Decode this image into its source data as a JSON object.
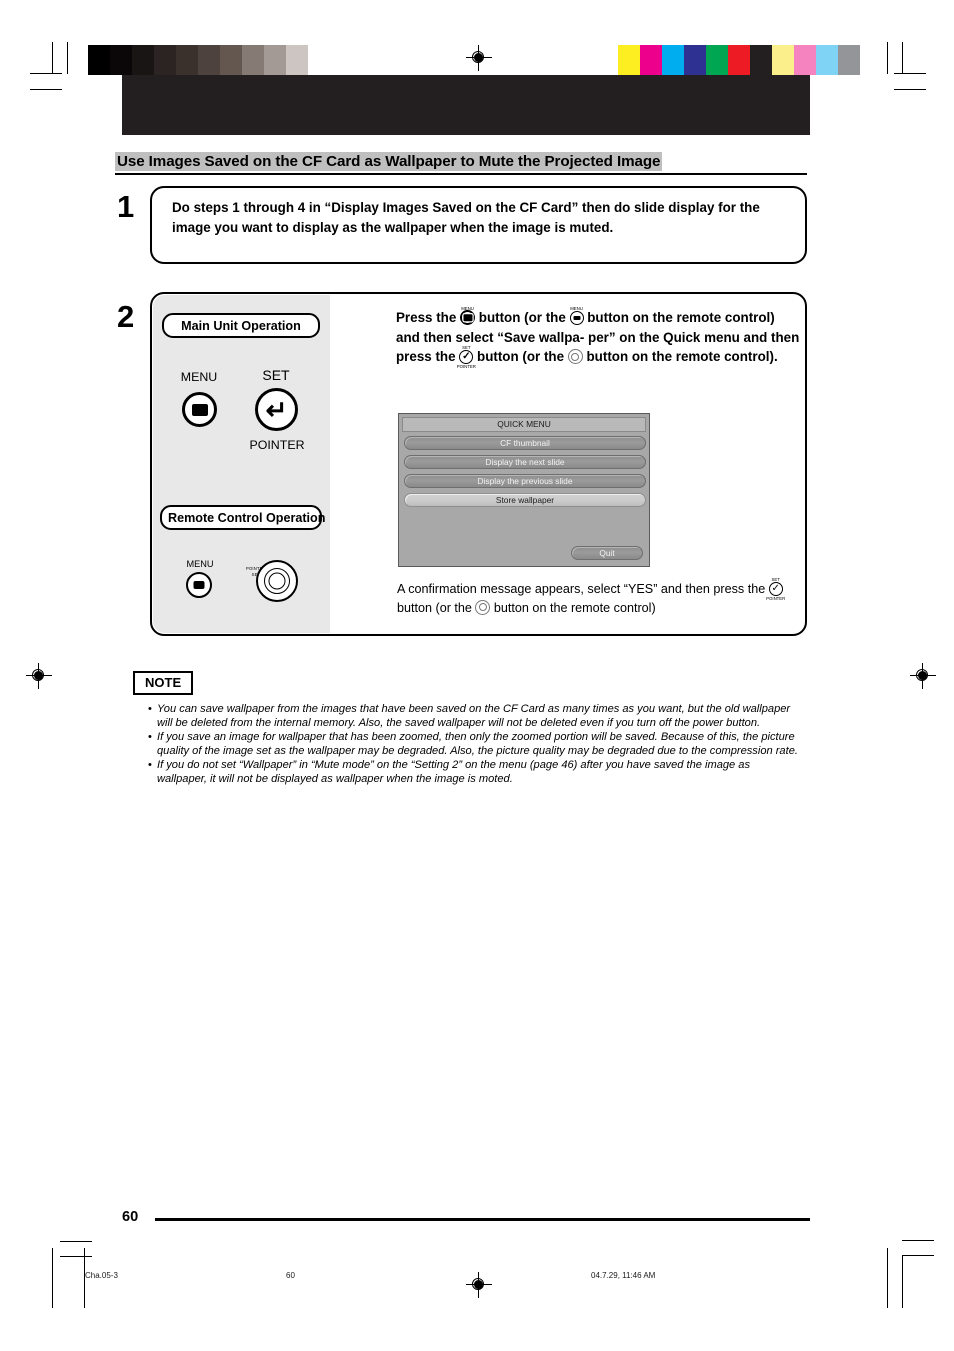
{
  "document": {
    "section_title": "Use Images Saved on the CF Card as Wallpaper to Mute the Projected Image",
    "page_number": "60"
  },
  "steps": [
    {
      "number": "1",
      "text": "Do steps 1 through 4 in “Display Images Saved on the CF Card” then do slide display for the image you want to display as the wallpaper when the image is muted."
    },
    {
      "number": "2",
      "text_parts": {
        "p1": "Press the",
        "p2": "button (or the",
        "p3": "button on the",
        "p4": "remote control) and then select “Save wallpa-",
        "p5": "per” on the Quick menu and then press the",
        "p6": "button (or the",
        "p7": "button on the remote control)."
      }
    }
  ],
  "hardware_panel": {
    "main_unit_label": "Main Unit Operation",
    "remote_label": "Remote Control Operation",
    "main_unit_buttons": [
      {
        "caption": "MENU",
        "icon": "menu-button-icon",
        "position": "above"
      },
      {
        "caption": "SET",
        "sub_caption": "POINTER",
        "icon": "set-enter-button-icon"
      }
    ],
    "remote_buttons": [
      {
        "caption": "MENU",
        "icon": "remote-menu-button-icon"
      },
      {
        "caption_top": "POINTER",
        "caption_sub": "SET",
        "icon": "remote-pointer-dial-icon"
      }
    ]
  },
  "glyph_captions": {
    "menu": "MENU",
    "set": "SET",
    "pointer": "POINTER"
  },
  "osd": {
    "title": "QUICK MENU",
    "items": [
      {
        "label": "CF thumbnail",
        "selected": false
      },
      {
        "label": "Display the next slide",
        "selected": false
      },
      {
        "label": "Display the previous slide",
        "selected": false
      },
      {
        "label": "Store wallpaper",
        "selected": true
      }
    ],
    "quit_label": "Quit"
  },
  "confirmation": {
    "line1_a": "A confirmation message appears, select “YES” and then press",
    "line2_a": "the",
    "line2_b": "button (or the",
    "line2_c": "button on the remote control)"
  },
  "note": {
    "badge": "NOTE",
    "bullet_char": "•",
    "items": [
      "You can save wallpaper from the images that have been saved on the CF Card as many times as you want, but the old wallpaper will be deleted from the internal memory. Also, the saved wallpaper will not be deleted even if you turn off the power button.",
      "If you save an image for wallpaper that has been zoomed, then only the zoomed portion will be saved. Because of this, the picture quality of the image set as the wallpaper may be degraded. Also, the picture quality may be degraded due to the compression rate.",
      "If you do not set “Wallpaper” in “Mute mode” on the “Setting 2” on the menu (page 46) after you have saved the image as wallpaper, it will not be displayed as wallpaper when the image is moted."
    ]
  },
  "imprint": {
    "file": "Cha.05-3",
    "page": "60",
    "timestamp": "04.7.29, 11:46 AM"
  },
  "calibration": {
    "grayscale": [
      "#000000",
      "#0b0708",
      "#1a1515",
      "#2b2422",
      "#3a302c",
      "#4d423d",
      "#645750",
      "#857a74",
      "#a39a95",
      "#cdc5c2",
      "#ffffff"
    ],
    "colors": [
      "#fcee21",
      "#ec008c",
      "#00aeef",
      "#2e3192",
      "#00a651",
      "#ed1c24",
      "#231f20",
      "#fbef8c",
      "#f483bf",
      "#7fd4f5",
      "#939598"
    ]
  },
  "theme": {
    "banner": "#231f20",
    "title_highlight": "#bfbfbf",
    "panel_grey": "#e8e8e8",
    "osd_bg": "#a8a8a8"
  }
}
